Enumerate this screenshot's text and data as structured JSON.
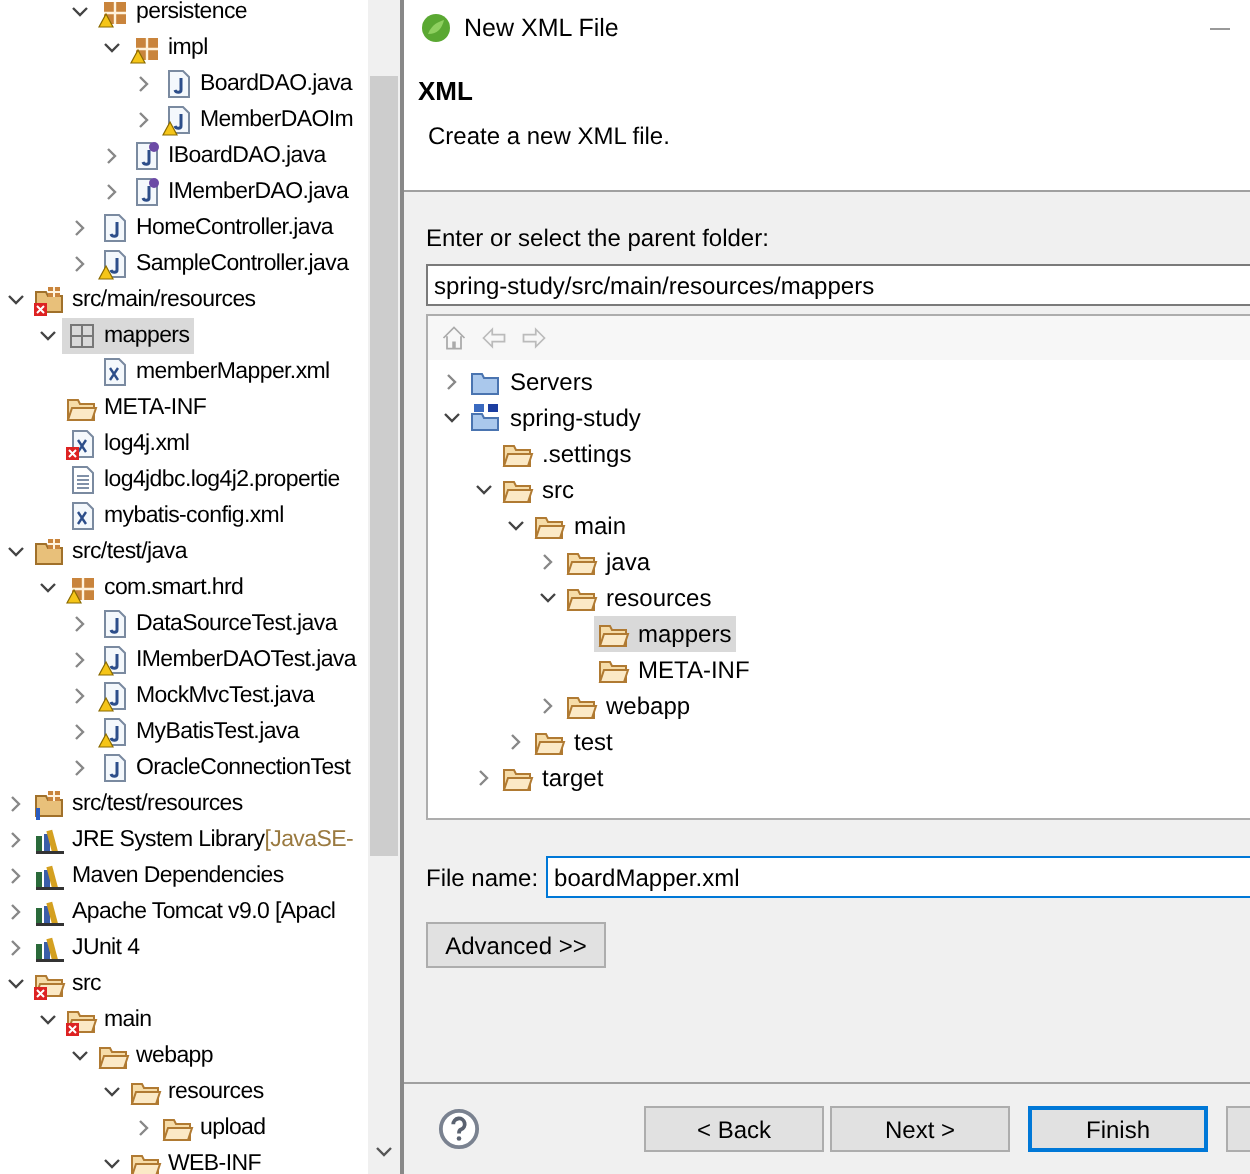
{
  "explorer": {
    "continued_items": [
      {
        "label": "persistence",
        "kind": "package",
        "warning": true,
        "expanded": true,
        "selected": false,
        "children": [
          {
            "label": "impl",
            "kind": "package",
            "warning": true,
            "expanded": true,
            "selected": false,
            "children": [
              {
                "label": "BoardDAO.java",
                "kind": "java",
                "expanded": false,
                "selected": false
              },
              {
                "label": "MemberDAOIm",
                "kind": "java",
                "warning": true,
                "expanded": false,
                "selected": false
              }
            ]
          },
          {
            "label": "IBoardDAO.java",
            "kind": "interface",
            "expanded": false,
            "selected": false
          },
          {
            "label": "IMemberDAO.java",
            "kind": "interface",
            "expanded": false,
            "selected": false
          }
        ]
      },
      {
        "label": "HomeController.java",
        "kind": "java",
        "expanded": false,
        "selected": false
      },
      {
        "label": "SampleController.java",
        "kind": "java",
        "warning": true,
        "expanded": false,
        "selected": false
      }
    ],
    "items": [
      {
        "label": "src/main/resources",
        "kind": "sourcefolder",
        "error": true,
        "expanded": true,
        "selected": false,
        "children": [
          {
            "label": "mappers",
            "kind": "emptypackage",
            "expanded": true,
            "selected": true,
            "children": [
              {
                "label": "memberMapper.xml",
                "kind": "xml",
                "selected": false
              }
            ]
          },
          {
            "label": "META-INF",
            "kind": "folder",
            "selected": false
          },
          {
            "label": "log4j.xml",
            "kind": "xml",
            "error": true,
            "selected": false
          },
          {
            "label": "log4jdbc.log4j2.propertie",
            "kind": "text",
            "selected": false
          },
          {
            "label": "mybatis-config.xml",
            "kind": "xml",
            "selected": false
          }
        ]
      },
      {
        "label": "src/test/java",
        "kind": "sourcefolder",
        "expanded": true,
        "selected": false,
        "children": [
          {
            "label": "com.smart.hrd",
            "kind": "package",
            "warning": true,
            "expanded": true,
            "selected": false,
            "children": [
              {
                "label": "DataSourceTest.java",
                "kind": "java",
                "expanded": false,
                "selected": false
              },
              {
                "label": "IMemberDAOTest.java",
                "kind": "java",
                "warning": true,
                "expanded": false,
                "selected": false
              },
              {
                "label": "MockMvcTest.java",
                "kind": "java",
                "warning": true,
                "expanded": false,
                "selected": false
              },
              {
                "label": "MyBatisTest.java",
                "kind": "java",
                "warning": true,
                "expanded": false,
                "selected": false
              },
              {
                "label": "OracleConnectionTest",
                "kind": "java",
                "expanded": false,
                "selected": false
              }
            ]
          }
        ]
      },
      {
        "label": "src/test/resources",
        "kind": "sourcefolder",
        "info": true,
        "expanded": false,
        "selected": false
      },
      {
        "label": "JRE System Library",
        "decoration": "[JavaSE-",
        "kind": "library",
        "expanded": false,
        "selected": false
      },
      {
        "label": "Maven Dependencies",
        "kind": "library",
        "expanded": false,
        "selected": false
      },
      {
        "label": "Apache Tomcat v9.0 [Apacl",
        "kind": "library",
        "expanded": false,
        "selected": false
      },
      {
        "label": "JUnit 4",
        "kind": "library",
        "expanded": false,
        "selected": false
      },
      {
        "label": "src",
        "kind": "folder",
        "error": true,
        "expanded": true,
        "selected": false,
        "children": [
          {
            "label": "main",
            "kind": "folder",
            "error": true,
            "expanded": true,
            "selected": false,
            "children": [
              {
                "label": "webapp",
                "kind": "folder",
                "expanded": true,
                "selected": false,
                "children": [
                  {
                    "label": "resources",
                    "kind": "folder",
                    "expanded": true,
                    "selected": false,
                    "children": [
                      {
                        "label": "upload",
                        "kind": "folder",
                        "expanded": false,
                        "selected": false
                      }
                    ]
                  },
                  {
                    "label": "WEB-INF",
                    "kind": "folder",
                    "expanded": true,
                    "selected": false
                  }
                ]
              }
            ]
          }
        ]
      }
    ]
  },
  "dialog": {
    "title": "New XML File",
    "heading": "XML",
    "description": "Create a new XML file.",
    "folder_label": "Enter or select the parent folder:",
    "folder_value": "spring-study/src/main/resources/mappers",
    "folder_tree": [
      {
        "label": "Servers",
        "kind": "closedproject",
        "expanded": false,
        "selected": false
      },
      {
        "label": "spring-study",
        "kind": "project",
        "expanded": true,
        "selected": false,
        "children": [
          {
            "label": ".settings",
            "kind": "folder",
            "selected": false
          },
          {
            "label": "src",
            "kind": "folder",
            "expanded": true,
            "selected": false,
            "children": [
              {
                "label": "main",
                "kind": "folder",
                "expanded": true,
                "selected": false,
                "children": [
                  {
                    "label": "java",
                    "kind": "folder",
                    "expanded": false,
                    "selected": false
                  },
                  {
                    "label": "resources",
                    "kind": "folder",
                    "expanded": true,
                    "selected": false,
                    "children": [
                      {
                        "label": "mappers",
                        "kind": "folder",
                        "selected": true
                      },
                      {
                        "label": "META-INF",
                        "kind": "folder",
                        "selected": false
                      }
                    ]
                  },
                  {
                    "label": "webapp",
                    "kind": "folder",
                    "expanded": false,
                    "selected": false
                  }
                ]
              },
              {
                "label": "test",
                "kind": "folder",
                "expanded": false,
                "selected": false
              }
            ]
          },
          {
            "label": "target",
            "kind": "folder",
            "expanded": false,
            "selected": false
          }
        ]
      }
    ],
    "file_name_label": "File name:",
    "file_name_value": "boardMapper.xml",
    "advanced_button": "Advanced >>",
    "buttons": [
      {
        "label": "< Back",
        "default": false
      },
      {
        "label": "Next >",
        "default": false
      },
      {
        "label": "Finish",
        "default": true
      }
    ]
  }
}
